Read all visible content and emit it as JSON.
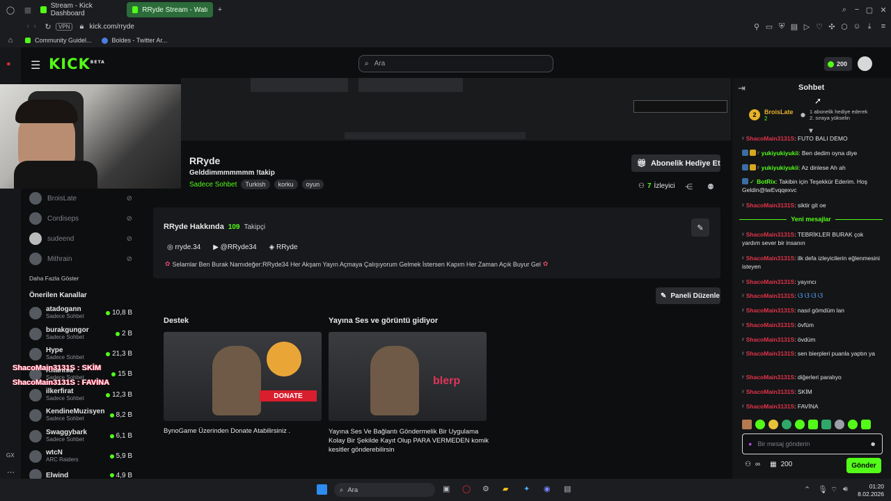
{
  "browser": {
    "tabs": [
      {
        "label": "Stream - Kick Dashboard"
      },
      {
        "label": "RRyde Stream - Watch Li"
      }
    ],
    "vpn": "VPN",
    "url": "kick.com/rryde",
    "bookmarks": [
      "Community Guidel...",
      "Boldes - Twitter Ar..."
    ]
  },
  "header": {
    "logo": "KICK",
    "logo_sup": "BETA",
    "search_placeholder": "Ara",
    "points": "200"
  },
  "channel": {
    "name": "RRyde",
    "title": "Gelddimmmmmmm !takip",
    "category": "Sadece Sohbet",
    "tags": [
      "Turkish",
      "korku",
      "oyun"
    ],
    "sub_button": "Abonelik Hediye Et",
    "viewers": "7",
    "viewers_label": "İzleyici"
  },
  "sidebar": {
    "followed": [
      {
        "name": "BroisLate"
      },
      {
        "name": "Cordiseps"
      },
      {
        "name": "sudeend"
      },
      {
        "name": "Mithrain"
      }
    ],
    "show_more": "Daha Fazla Göster",
    "recommended_title": "Önerilen Kanallar",
    "recommended": [
      {
        "name": "atadogann",
        "category": "Sadece Sohbet",
        "count": "10,8 B"
      },
      {
        "name": "burakgungor",
        "category": "Sadece Sohbet",
        "count": "2 B"
      },
      {
        "name": "Hype",
        "category": "Sadece Sohbet",
        "count": "21,3 B"
      },
      {
        "name": "Kitanisa",
        "category": "Sadece Sohbet",
        "count": "15 B"
      },
      {
        "name": "ilkerfirat",
        "category": "Sadece Sohbet",
        "count": "12,3 B"
      },
      {
        "name": "KendineMuzisyen",
        "category": "Sadece Sohbet",
        "count": "8,2 B"
      },
      {
        "name": "Swaggybark",
        "category": "Sadece Sohbet",
        "count": "6,1 B"
      },
      {
        "name": "wtcN",
        "category": "ARC Raiders",
        "count": "5,9 B"
      },
      {
        "name": "Elwind",
        "category": "",
        "count": "4,9 B"
      }
    ],
    "overlay1": "ShacoMain3131S : SKİM",
    "overlay2": "ShacoMain3131S : FAVİNA"
  },
  "about": {
    "title": "RRyde Hakkında",
    "followers": "109",
    "followers_label": "Takipçi",
    "socials": [
      "rryde.34",
      "@RRyde34",
      "RRyde"
    ],
    "bio": "Selamlar Ben Burak Namıdeğer:RRyde34 Her Akşam Yayın Açmaya Çalışıyorum Gelmek İstersen Kapım Her Zaman Açık Buyur Gel"
  },
  "panels": {
    "edit_button": "Paneli Düzenle",
    "items": [
      {
        "title": "Destek",
        "badge": "DONATE",
        "desc": "BynoGame Üzerinden Donate Atabilirsiniz ."
      },
      {
        "title": "Yayına Ses ve görüntü gidiyor",
        "badge": "blerp",
        "desc": "Yayına Ses Ve Bağlantı Göndermelik Bir Uygulama Kolay Bir Şekilde Kayıt Olup PARA VERMEDEN komik kesitler gönderebilirsin"
      }
    ]
  },
  "chat": {
    "title": "Sohbet",
    "pinned_user": "BroisLate",
    "pinned_num": "2",
    "pinned_text": "1 abonelik hediye ederek 2. sıraya yükselin",
    "new_messages": "Yeni mesajlar",
    "messages": [
      {
        "user": "ShacoMain3131S",
        "text": "FUTO BALI DEMO",
        "color": "#e0344a"
      },
      {
        "user": "yukiyukiyukii",
        "text": "Ben dedim oyna diye",
        "color": "#53fc18"
      },
      {
        "user": "yukiyukiyukii",
        "text": "Az dinlese Ah ah",
        "color": "#53fc18"
      },
      {
        "user": "BotRix",
        "text": "Takibin için Teşekkür Ederim. Hoş Geldin@twEvqqexvc",
        "color": "#53fc18"
      },
      {
        "user": "ShacoMain3131S",
        "text": "siktir git oe",
        "color": "#e0344a"
      },
      {
        "user": "ShacoMain3131S",
        "text": "TEBRİKLER BURAK çok yardım sever bir insanın",
        "color": "#e0344a"
      },
      {
        "user": "ShacoMain3131S",
        "text": "ilk defa izleyicilerin eğlenmesini isteyen",
        "color": "#e0344a"
      },
      {
        "user": "ShacoMain3131S",
        "text": "yayıncı",
        "color": "#e0344a"
      },
      {
        "user": "ShacoMain3131S",
        "text": "",
        "color": "#e0344a"
      },
      {
        "user": "ShacoMain3131S",
        "text": "nasıl gömdüm lan",
        "color": "#e0344a"
      },
      {
        "user": "ShacoMain3131S",
        "text": "övfüm",
        "color": "#e0344a"
      },
      {
        "user": "ShacoMain3131S",
        "text": "övdüm",
        "color": "#e0344a"
      },
      {
        "user": "ShacoMain3131S",
        "text": "sen bierpleri puanla yaptın ya",
        "color": "#e0344a"
      },
      {
        "user": "ShacoMain3131S",
        "text": "diğerleri paralıyo",
        "color": "#e0344a"
      },
      {
        "user": "ShacoMain3131S",
        "text": "SKİM",
        "color": "#e0344a"
      },
      {
        "user": "ShacoMain3131S",
        "text": "FAVİNA",
        "color": "#e0344a"
      }
    ],
    "input_placeholder": "Bir mesaj gönderin",
    "points": "200",
    "send": "Gönder"
  },
  "taskbar": {
    "search": "Ara",
    "time": "01:20",
    "date": "8.02.2026"
  }
}
